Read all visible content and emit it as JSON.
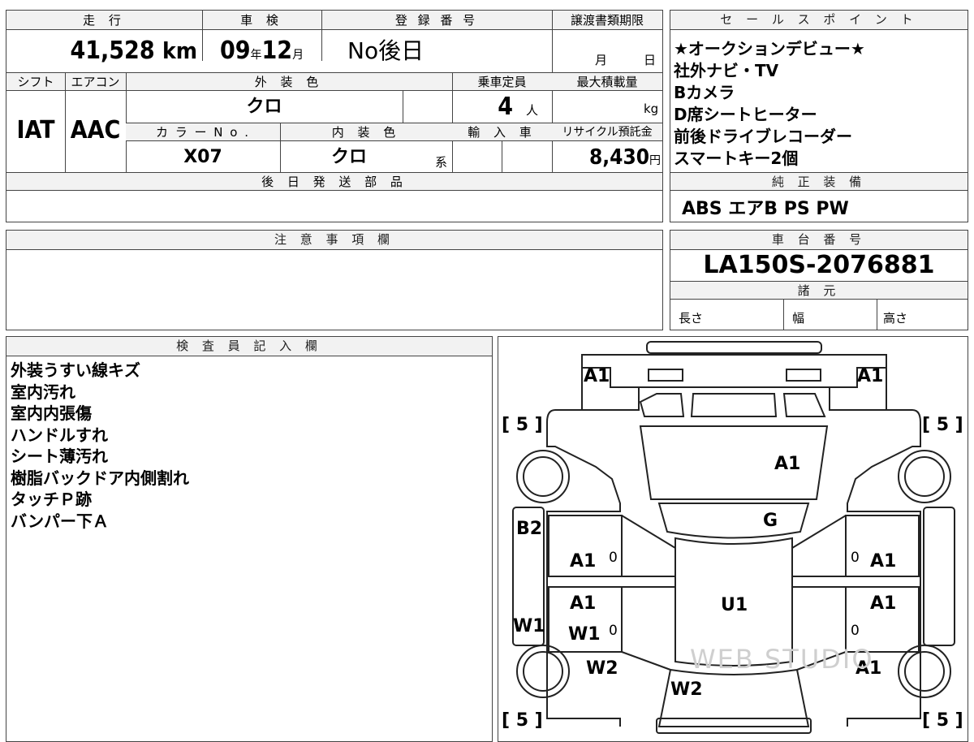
{
  "main_table": {
    "mileage_label": "走 行",
    "mileage_value": "41,528",
    "mileage_unit": "km",
    "inspection_label": "車 検",
    "inspection_year": "09",
    "inspection_year_unit": "年",
    "inspection_month": "12",
    "inspection_month_unit": "月",
    "registration_label": "登 録 番 号",
    "registration_value": "No後日",
    "transfer_deadline_label": "譲渡書類期限",
    "transfer_month_unit": "月",
    "transfer_day_unit": "日",
    "shift_label": "シフト",
    "shift_value": "IAT",
    "aircon_label": "エアコン",
    "aircon_value": "AAC",
    "exterior_color_label": "外 装 色",
    "exterior_color_value": "クロ",
    "capacity_label": "乗車定員",
    "capacity_value": "4",
    "capacity_unit": "人",
    "max_load_label": "最大積載量",
    "max_load_unit": "kg",
    "color_no_label": "カ ラ ー N o .",
    "color_no_value": "X07",
    "interior_color_label": "内 装 色",
    "interior_color_value": "クロ",
    "interior_color_suffix": "系",
    "import_label": "輸 入 車",
    "recycle_label": "リサイクル預託金",
    "recycle_value": "8,430",
    "recycle_unit": "円",
    "later_parts_label": "後 日 発 送 部 品",
    "notes_label": "注 意 事 項 欄"
  },
  "sales_points": {
    "label": "セ ー ル ス ポ イ ン ト",
    "lines": [
      "★オークションデビュー★",
      "社外ナビ・TV",
      "Bカメラ",
      "D席シートヒーター",
      "前後ドライブレコーダー",
      "スマートキー2個"
    ]
  },
  "genuine_equipment": {
    "label": "純 正 装 備",
    "value": "ABS エアB PS PW"
  },
  "chassis": {
    "label": "車 台 番 号",
    "value": "LA150S-2076881",
    "specs_label": "諸 元",
    "length_label": "長さ",
    "width_label": "幅",
    "height_label": "高さ"
  },
  "inspector": {
    "label": "検 査 員 記 入 欄",
    "lines": [
      "外装うすい線キズ",
      "室内汚れ",
      "室内内張傷",
      "ハンドルすれ",
      "シート薄汚れ",
      "樹脂バックドア内側割れ",
      "タッチＰ跡",
      "バンパー下Ａ"
    ]
  },
  "diagram": {
    "marks": {
      "front_left": "A1",
      "front_right": "A1",
      "tire_front_left": "[ 5 ]",
      "tire_front_right": "[ 5 ]",
      "tire_rear_left": "[ 5 ]",
      "tire_rear_right": "[ 5 ]",
      "hood": "A1",
      "windshield": "G",
      "left_pillar": "B2",
      "left_front_door": "A1",
      "left_front_zero": "0",
      "right_front_zero": "0",
      "right_front_door": "A1",
      "left_rear_door": "A1",
      "left_rear_w1": "W1",
      "left_rear_zero": "0",
      "roof": "U1",
      "right_rear_door": "A1",
      "right_rear_zero": "0",
      "left_sill": "W1",
      "left_quarter": "W2",
      "right_quarter": "A1",
      "rear_glass": "W2"
    },
    "watermark": "WEB STUDIO"
  }
}
